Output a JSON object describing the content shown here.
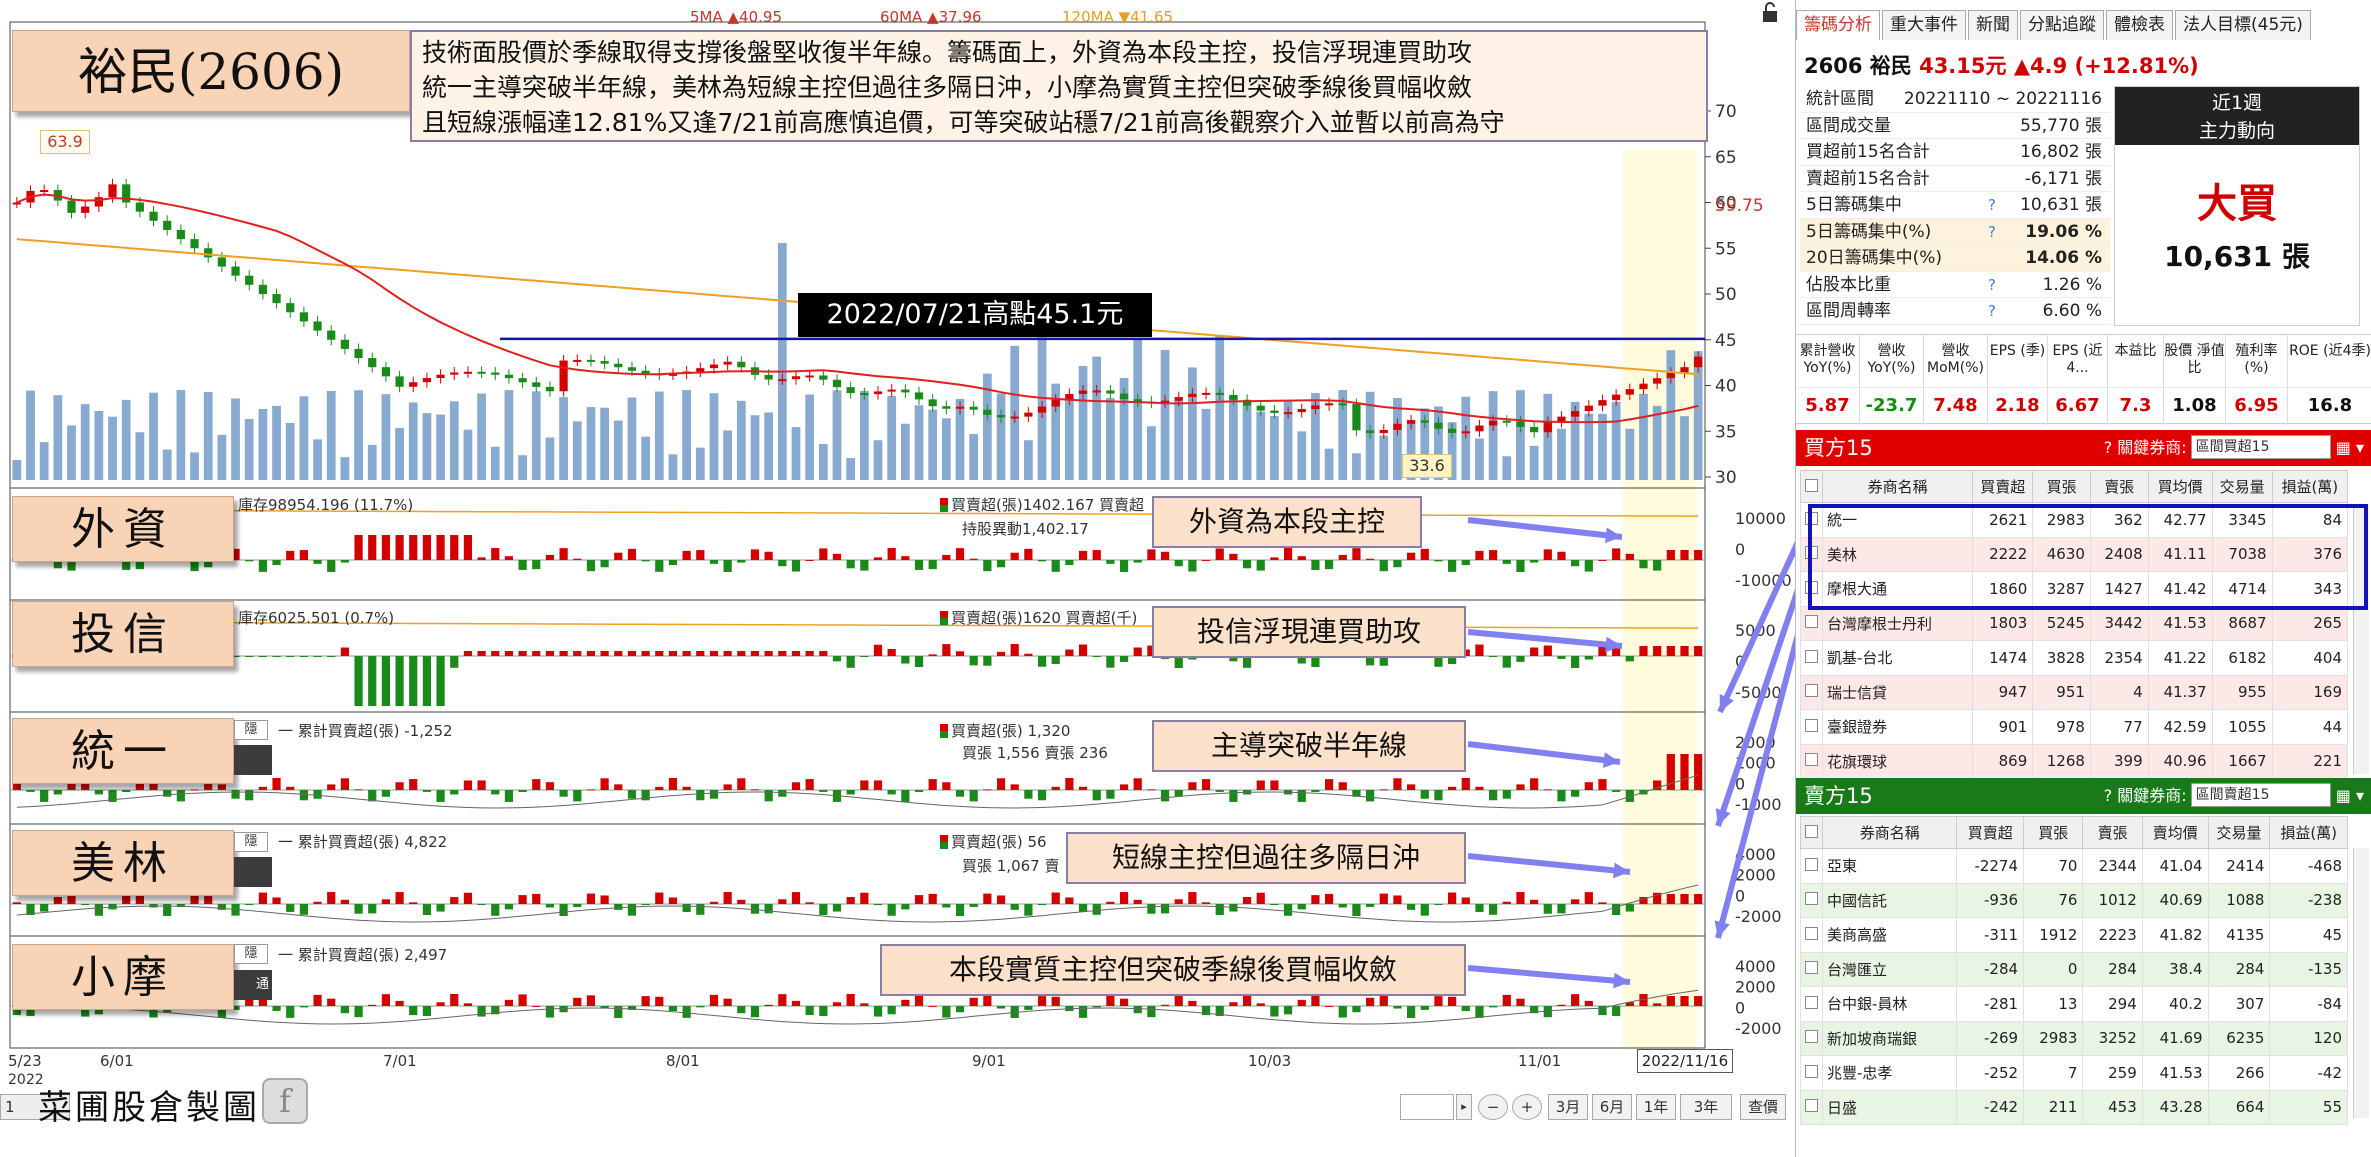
{
  "title": {
    "stock": "裕民(2606)"
  },
  "commentary": [
    "技術面股價於季線取得支撐後盤堅收復半年線。籌碼面上，外資為本段主控，投信浮現連買助攻",
    "統一主導突破半年線，美林為短線主控但過往多隔日沖，小摩為實質主控但突破季線後買幅收斂",
    "且短線漲幅達12.81%又逢7/21前高應慎追價，可等突破站穩7/21前高後觀察介入並暫以前高為守"
  ],
  "ma_legend": {
    "ma5": "5MA ▲40.95",
    "ma60": "60MA ▲37.96",
    "ma120": "120MA ▼41.65"
  },
  "price_axis": {
    "ticks": [
      "70",
      "65",
      "60",
      "55",
      "50",
      "45",
      "40",
      "35",
      "30"
    ],
    "current": "59.75"
  },
  "high_line_label": "2022/07/21高點45.1元",
  "max_label": "63.9",
  "min_label": "33.6",
  "panels": [
    {
      "tag": "外資",
      "info": "庫存98954.196 (11.7%)",
      "flow": "買賣超(張)1402.167 買賣超",
      "flow2": "持股異動1,402.17",
      "callout": "外資為本段主控",
      "ticks": [
        "10000",
        "0",
        "-10000"
      ]
    },
    {
      "tag": "投信",
      "info": "庫存6025.501 (0.7%)",
      "flow": "買賣超(張)1620 買賣超(千)",
      "flow2": "",
      "callout": "投信浮現連買助攻",
      "ticks": [
        "5000",
        "0",
        "-5000"
      ]
    },
    {
      "tag": "統一",
      "info": "一 累計買賣超(張) -1,252",
      "flow": "買賣超(張) 1,320",
      "flow2": "買張 1,556 賣張 236",
      "callout": "主導突破半年線",
      "ticks": [
        "2000",
        "1000",
        "0",
        "-1000"
      ],
      "btn": "隱"
    },
    {
      "tag": "美林",
      "info": "一 累計買賣超(張) 4,822",
      "flow": "買賣超(張) 56",
      "flow2": "買張 1,067 賣",
      "callout": "短線主控但過往多隔日沖",
      "ticks": [
        "4000",
        "2000",
        "0",
        "-2000"
      ],
      "btn": "隱"
    },
    {
      "tag": "小摩",
      "info": "一 累計買賣超(張) 2,497",
      "flow": "",
      "flow2": "",
      "callout": "本段實質主控但突破季線後買幅收斂",
      "ticks": [
        "4000",
        "2000",
        "0",
        "-2000"
      ],
      "btn": "隱",
      "dark": "通"
    }
  ],
  "x_axis": {
    "labels": [
      "5/23",
      "6/01",
      "7/01",
      "8/01",
      "9/01",
      "10/03",
      "11/01"
    ],
    "year": "2022",
    "current_date": "2022/11/16"
  },
  "footer": {
    "logo": "菜圃股倉製圖",
    "fb": "f",
    "pager": "1",
    "ranges": [
      "3月",
      "6月",
      "1年",
      "3年"
    ],
    "query": "查價"
  },
  "right_panel": {
    "tabs": [
      "籌碼分析",
      "重大事件",
      "新聞",
      "分點追蹤",
      "體檢表",
      "法人目標(45元)"
    ],
    "quote": {
      "code_name": "2606 裕民",
      "price": "43.15元",
      "change": "▲4.9 (+12.81%)"
    },
    "stats": [
      {
        "label": "統計區間",
        "q": "",
        "value": "20221110 ~ 20221116"
      },
      {
        "label": "區間成交量",
        "q": "",
        "value": "55,770 張"
      },
      {
        "label": "買超前15名合計",
        "q": "",
        "value": "16,802 張"
      },
      {
        "label": "賣超前15名合計",
        "q": "",
        "value": "-6,171 張"
      },
      {
        "label": "5日籌碼集中",
        "q": "?",
        "value": "10,631 張"
      },
      {
        "label": "5日籌碼集中(%)",
        "q": "?",
        "value": "19.06 %"
      },
      {
        "label": "20日籌碼集中(%)",
        "q": "",
        "value": "14.06 %"
      },
      {
        "label": "佔股本比重",
        "q": "?",
        "value": "1.26 %"
      },
      {
        "label": "區間周轉率",
        "q": "?",
        "value": "6.60 %"
      }
    ],
    "trend": {
      "period": "近1週",
      "sub": "主力動向",
      "verdict": "大買",
      "amount": "10,631 張"
    },
    "metrics": [
      {
        "h": "累計營收 YoY(%)",
        "v": "5.87",
        "c": "#d10000"
      },
      {
        "h": "營收 YoY(%)",
        "v": "-23.7",
        "c": "#109010"
      },
      {
        "h": "營收 MoM(%)",
        "v": "7.48",
        "c": "#d10000"
      },
      {
        "h": "EPS (季)",
        "v": "2.18",
        "c": "#d10000"
      },
      {
        "h": "EPS (近4...",
        "v": "6.67",
        "c": "#d10000"
      },
      {
        "h": "本益比",
        "v": "7.3",
        "c": "#d10000"
      },
      {
        "h": "股價 淨值比",
        "v": "1.08",
        "c": "#111"
      },
      {
        "h": "殖利率 (%)",
        "v": "6.95",
        "c": "#d10000"
      },
      {
        "h": "ROE (近4季)",
        "v": "16.8",
        "c": "#111"
      }
    ],
    "buy": {
      "title": "買方15",
      "filter_label": "關鍵券商:",
      "filter_value": "區間買超15",
      "headers": [
        "券商名稱",
        "買賣超",
        "買張",
        "賣張",
        "買均價",
        "交易量",
        "損益(萬)"
      ],
      "rows": [
        [
          "統一",
          "2621",
          "2983",
          "362",
          "42.77",
          "3345",
          "84"
        ],
        [
          "美林",
          "2222",
          "4630",
          "2408",
          "41.11",
          "7038",
          "376"
        ],
        [
          "摩根大通",
          "1860",
          "3287",
          "1427",
          "41.42",
          "4714",
          "343"
        ],
        [
          "台灣摩根士丹利",
          "1803",
          "5245",
          "3442",
          "41.53",
          "8687",
          "265"
        ],
        [
          "凱基-台北",
          "1474",
          "3828",
          "2354",
          "41.22",
          "6182",
          "404"
        ],
        [
          "瑞士信貸",
          "947",
          "951",
          "4",
          "41.37",
          "955",
          "169"
        ],
        [
          "臺銀證券",
          "901",
          "978",
          "77",
          "42.59",
          "1055",
          "44"
        ],
        [
          "花旗環球",
          "869",
          "1268",
          "399",
          "40.96",
          "1667",
          "221"
        ]
      ]
    },
    "sell": {
      "title": "賣方15",
      "filter_label": "關鍵券商:",
      "filter_value": "區間賣超15",
      "headers": [
        "券商名稱",
        "買賣超",
        "買張",
        "賣張",
        "賣均價",
        "交易量",
        "損益(萬)"
      ],
      "rows": [
        [
          "亞東",
          "-2274",
          "70",
          "2344",
          "41.04",
          "2414",
          "-468"
        ],
        [
          "中國信託",
          "-936",
          "76",
          "1012",
          "40.69",
          "1088",
          "-238"
        ],
        [
          "美商高盛",
          "-311",
          "1912",
          "2223",
          "41.82",
          "4135",
          "45"
        ],
        [
          "台灣匯立",
          "-284",
          "0",
          "284",
          "38.4",
          "284",
          "-135"
        ],
        [
          "台中銀-員林",
          "-281",
          "13",
          "294",
          "40.2",
          "307",
          "-84"
        ],
        [
          "新加坡商瑞銀",
          "-269",
          "2983",
          "3252",
          "41.69",
          "6235",
          "120"
        ],
        [
          "兆豐-忠孝",
          "-252",
          "7",
          "259",
          "41.53",
          "266",
          "-42"
        ],
        [
          "日盛",
          "-242",
          "211",
          "453",
          "43.28",
          "664",
          "55"
        ]
      ]
    }
  },
  "colors": {
    "up": "#d40000",
    "down": "#1a8a1a",
    "ma5": "#e02020",
    "ma120": "#f0a020",
    "volume": "#88aad0",
    "highlight": "#1313b8",
    "arrow": "#8080f0"
  }
}
